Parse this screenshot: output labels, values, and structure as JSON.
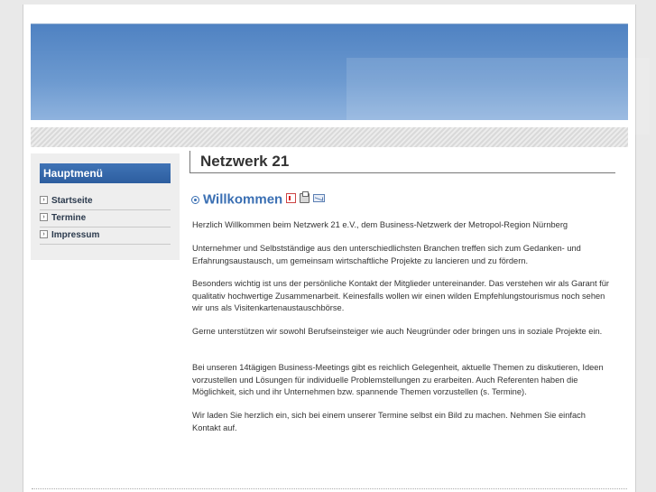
{
  "sidebar": {
    "title": "Hauptmenü",
    "items": [
      {
        "label": "Startseite"
      },
      {
        "label": "Termine"
      },
      {
        "label": "Impressum"
      }
    ]
  },
  "content": {
    "page_title": "Netzwerk 21",
    "article_title": "Willkommen",
    "icons": [
      "pdf-icon",
      "print-icon",
      "email-icon"
    ],
    "paragraphs": [
      "Herzlich Willkommen beim Netzwerk 21 e.V., dem Business-Netzwerk der Metropol-Region Nürnberg",
      "Unternehmer und Selbstständige aus den unterschiedlichsten Branchen treffen sich zum Gedanken- und Erfahrungsaustausch, um gemeinsam wirtschaftliche Projekte zu lancieren und zu fördern.",
      "Besonders wichtig ist uns der persönliche Kontakt der Mitglieder untereinander. Das verstehen wir als Garant für qualitativ hochwertige Zusammenarbeit. Keinesfalls wollen wir einen wilden Empfehlungstourismus noch sehen wir uns als Visitenkartenaustauschbörse.",
      "Gerne unterstützen wir sowohl Berufseinsteiger wie auch Neugründer oder bringen uns in soziale Projekte ein.",
      "Bei unseren 14tägigen Business-Meetings gibt es reichlich Gelegenheit, aktuelle Themen zu diskutieren, Ideen vorzustellen und Lösungen für individuelle Problemstellungen zu erarbeiten. Auch Referenten haben die Möglichkeit, sich und ihr Unternehmen bzw. spannende Themen vorzustellen (s. Termine).",
      "Wir laden Sie herzlich ein, sich bei einem unserer Termine selbst ein Bild zu machen. Nehmen Sie einfach Kontakt auf."
    ]
  },
  "colors": {
    "accent": "#3a6fb3",
    "banner": "#5f8fcb",
    "menu_title_bg": "#2d5e9f"
  }
}
